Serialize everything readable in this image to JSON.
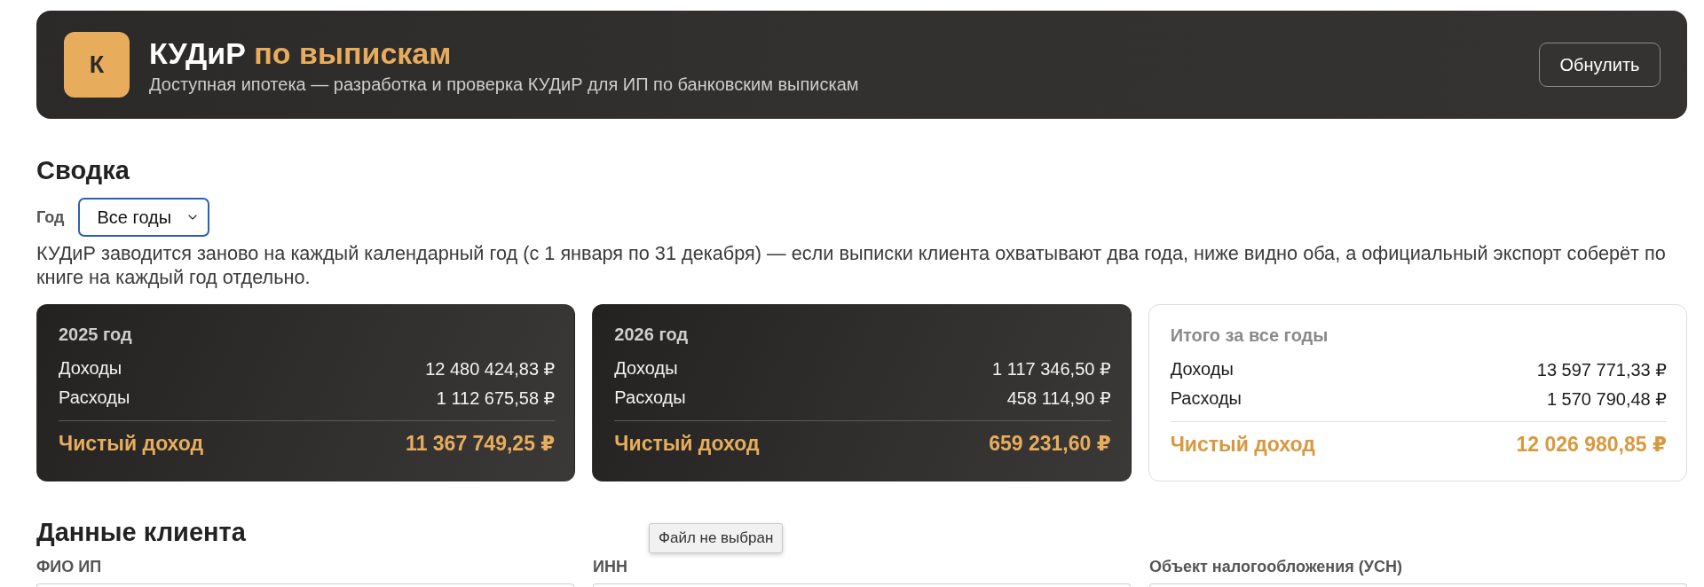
{
  "header": {
    "logo_letter": "К",
    "title": "КУДиР",
    "title_accent": "по выпискам",
    "subtitle": "Доступная ипотека — разработка и проверка КУДиР для ИП по банковским выпискам",
    "reset_button": "Обнулить"
  },
  "summary": {
    "heading": "Сводка",
    "year_select": {
      "label": "Год",
      "value": "Все годы",
      "focused": true
    },
    "note": "КУДиР заводится заново на каждый календарный год (с 1 января по 31 декабря) — если выписки клиента охватывают два года, ниже видно оба, а официальный экспорт соберёт по книге на каждый год отдельно.",
    "cards": [
      {
        "kind": "dark",
        "title": "2025 год",
        "rows": [
          {
            "label": "Доходы",
            "value": "12 480 424,83 ₽"
          },
          {
            "label": "Расходы",
            "value": "1 112 675,58 ₽"
          }
        ],
        "net": {
          "label": "Чистый доход",
          "value": "11 367 749,25 ₽"
        }
      },
      {
        "kind": "dark",
        "title": "2026 год",
        "rows": [
          {
            "label": "Доходы",
            "value": "1 117 346,50 ₽"
          },
          {
            "label": "Расходы",
            "value": "458 114,90 ₽"
          }
        ],
        "net": {
          "label": "Чистый доход",
          "value": "659 231,60 ₽"
        }
      },
      {
        "kind": "light",
        "title": "Итого за все годы",
        "rows": [
          {
            "label": "Доходы",
            "value": "13 597 771,33 ₽"
          },
          {
            "label": "Расходы",
            "value": "1 570 790,48 ₽"
          }
        ],
        "net": {
          "label": "Чистый доход",
          "value": "12 026 980,85 ₽"
        }
      }
    ]
  },
  "client_data": {
    "heading": "Данные клиента",
    "tooltip": "Файл не выбран",
    "fields": [
      {
        "label": "ФИО ИП"
      },
      {
        "label": "ИНН"
      },
      {
        "label": "Объект налогообложения (УСН)"
      }
    ]
  }
}
